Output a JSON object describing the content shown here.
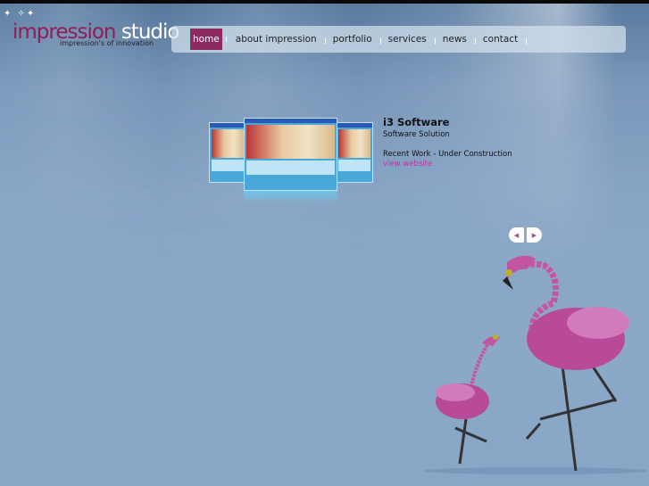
{
  "logo": {
    "stars": "✦ ✧✦",
    "word1": "impression",
    "word2": "studio",
    "tagline": "impression's of innovation"
  },
  "nav": {
    "items": [
      {
        "label": "home",
        "active": true
      },
      {
        "label": "about impression"
      },
      {
        "label": "portfolio"
      },
      {
        "label": "services"
      },
      {
        "label": "news"
      },
      {
        "label": "contact"
      }
    ]
  },
  "feature": {
    "title": "i3 Software",
    "subtitle": "Software Solution",
    "status": "Recent Work - Under Construction",
    "link": "view website"
  },
  "slider": {
    "prev": "◀",
    "next": "▶"
  },
  "colors": {
    "brand": "#8f1d56",
    "link": "#c42fa8",
    "active_nav": "#8b2a63"
  }
}
